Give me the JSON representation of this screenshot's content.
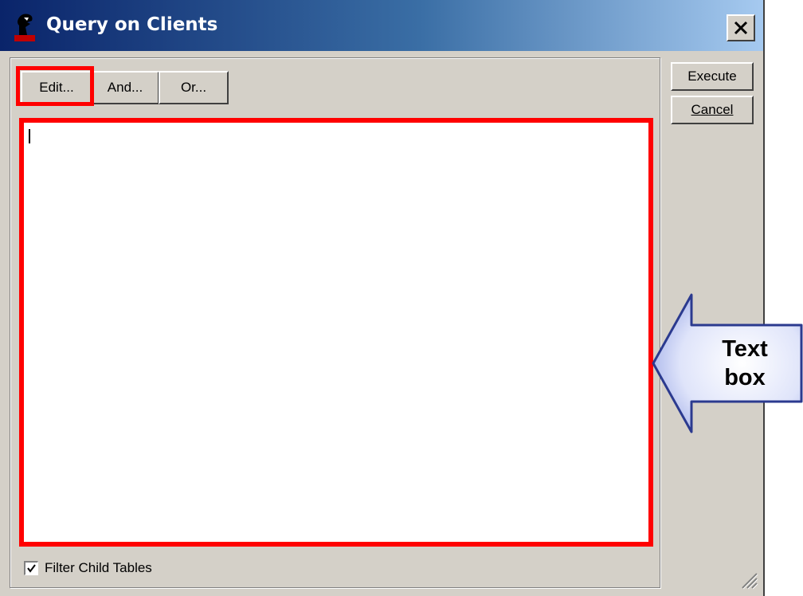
{
  "window": {
    "title": "Query on Clients",
    "close_icon": "close-icon",
    "app_icon": "app-icon"
  },
  "toolbar": {
    "edit_label": "Edit...",
    "and_label": "And...",
    "or_label": "Or..."
  },
  "side_buttons": {
    "execute_label": "Execute",
    "cancel_label": "Cancel"
  },
  "query_text": {
    "value": ""
  },
  "filter_child_tables": {
    "label": "Filter Child Tables",
    "checked": true
  },
  "annotation": {
    "line1": "Text",
    "line2": "box",
    "highlight_color": "#ff0000",
    "arrow_color": "#b8c4f0"
  }
}
